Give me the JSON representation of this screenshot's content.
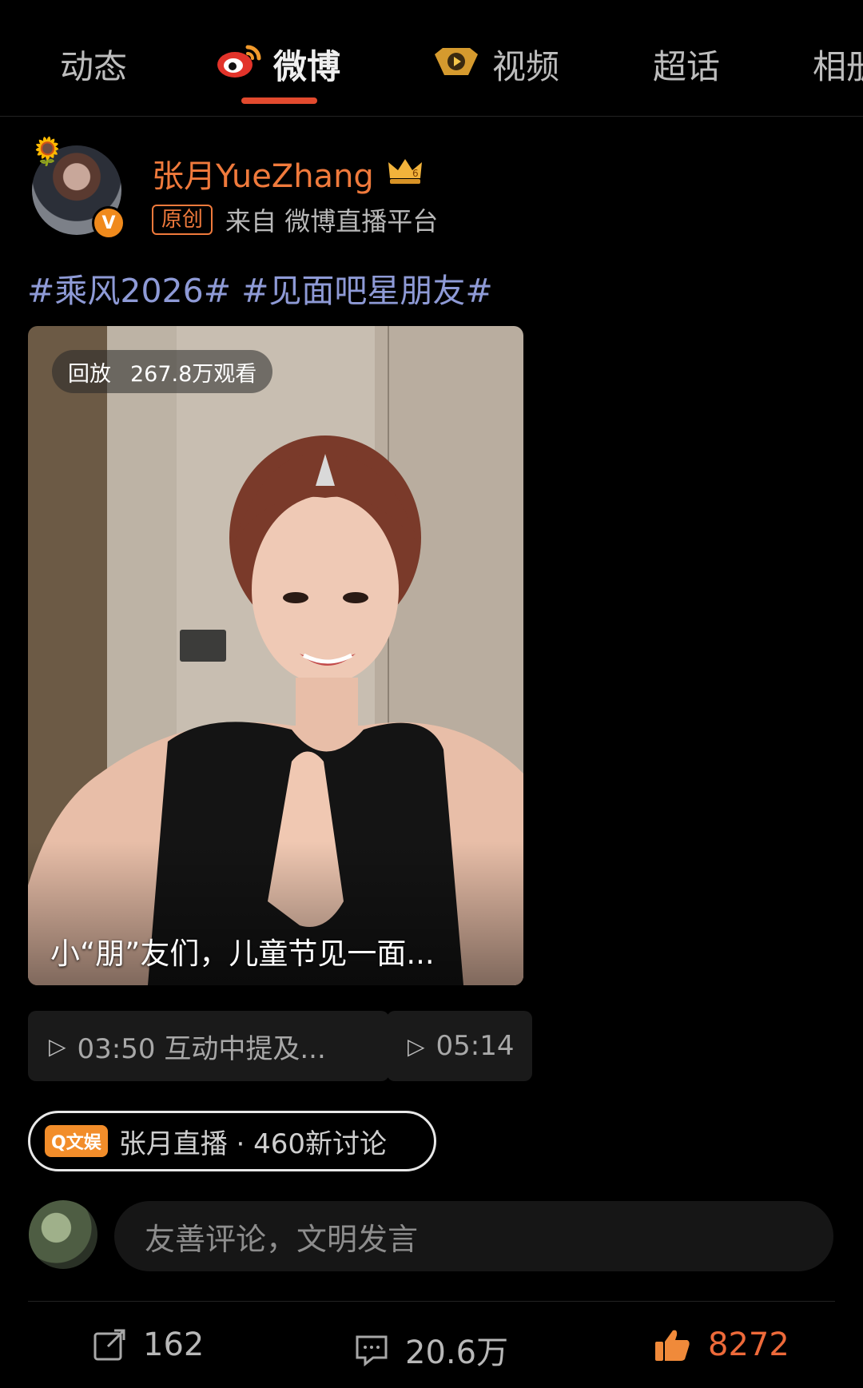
{
  "tabs": [
    {
      "label": "动态",
      "active": false
    },
    {
      "label": "微博",
      "active": true,
      "icon": "weibo-logo-icon"
    },
    {
      "label": "视频",
      "active": false,
      "icon": "video-play-icon"
    },
    {
      "label": "超话",
      "active": false
    },
    {
      "label": "相册",
      "active": false
    }
  ],
  "post": {
    "username": "张月YueZhang",
    "original_tag": "原创",
    "source": "来自 微博直播平台",
    "hashtags": "#乘风2026# #见面吧星朋友#",
    "video": {
      "status": "回放",
      "views": "267.8万观看",
      "caption": "小“朋”友们，儿童节见一面..."
    },
    "clips": [
      {
        "label": "03:50 互动中提及..."
      },
      {
        "label": "05:14"
      }
    ],
    "topic": {
      "badge": "Q文娱",
      "label": "张月直播 · 460新讨论"
    },
    "comment_placeholder": "友善评论，文明发言",
    "actions": {
      "reposts": "162",
      "comments": "20.6万",
      "likes": "8272"
    }
  },
  "colors": {
    "accent": "#f07a3c",
    "hashtag": "#8e9ad6",
    "active_underline": "#e24a2e",
    "background": "#000000"
  }
}
